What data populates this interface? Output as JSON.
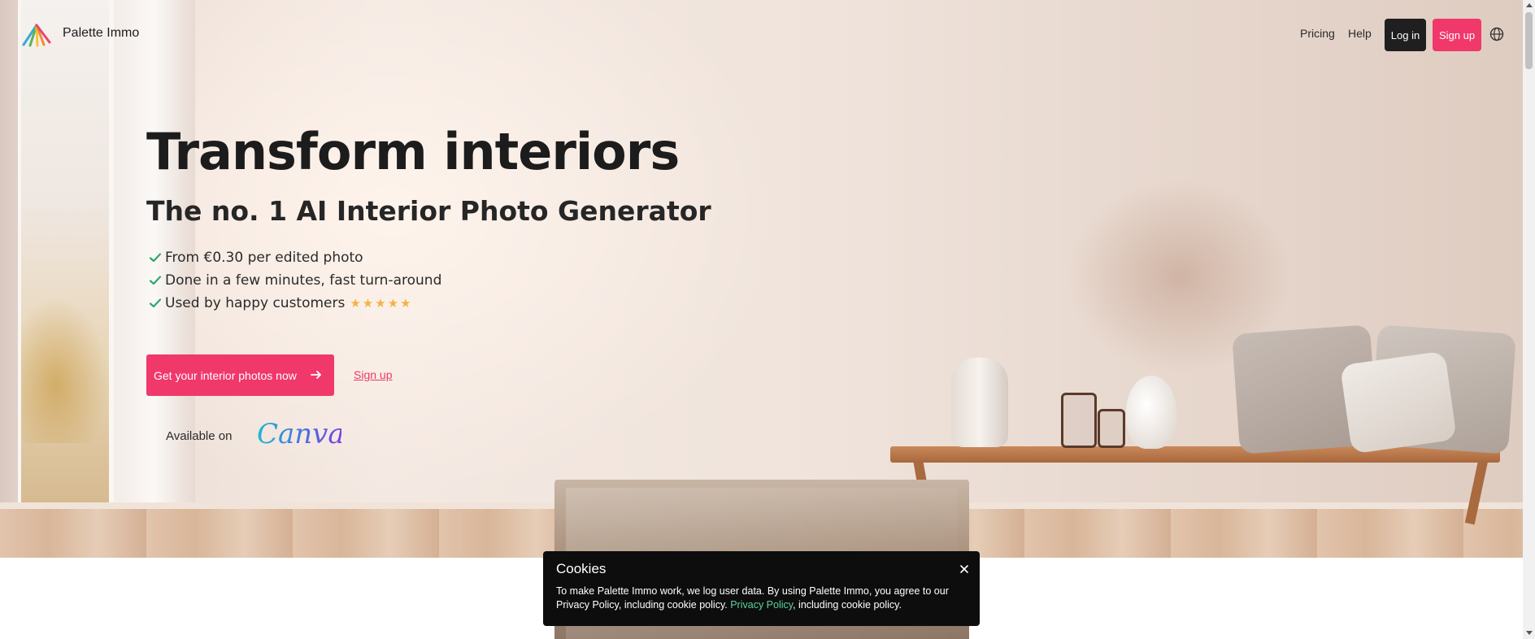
{
  "nav": {
    "brand": "Palette Immo",
    "pricing": "Pricing",
    "help": "Help",
    "login": "Log in",
    "signup": "Sign up"
  },
  "hero": {
    "title": "Transform interiors",
    "subtitle": "The no. 1 AI Interior Photo Generator",
    "features": [
      "From €0.30 per edited photo",
      "Done in a few minutes, fast turn-around",
      "Used by happy customers"
    ],
    "rating_stars": "★★★★★",
    "cta": "Get your interior photos now",
    "signup_link": "Sign up",
    "available_on": "Available on",
    "canva": "Canva"
  },
  "cookie": {
    "title": "Cookies",
    "text_before": "To make Palette Immo work, we log user data. By using Palette Immo, you agree to our Privacy Policy, including cookie policy. ",
    "link": "Privacy Policy",
    "text_after": ", including cookie policy."
  },
  "colors": {
    "accent": "#f0386b",
    "check": "#2fa86b",
    "star": "#f3b24a",
    "dark": "#1f1f1f",
    "cookie_link": "#5ad39c"
  }
}
